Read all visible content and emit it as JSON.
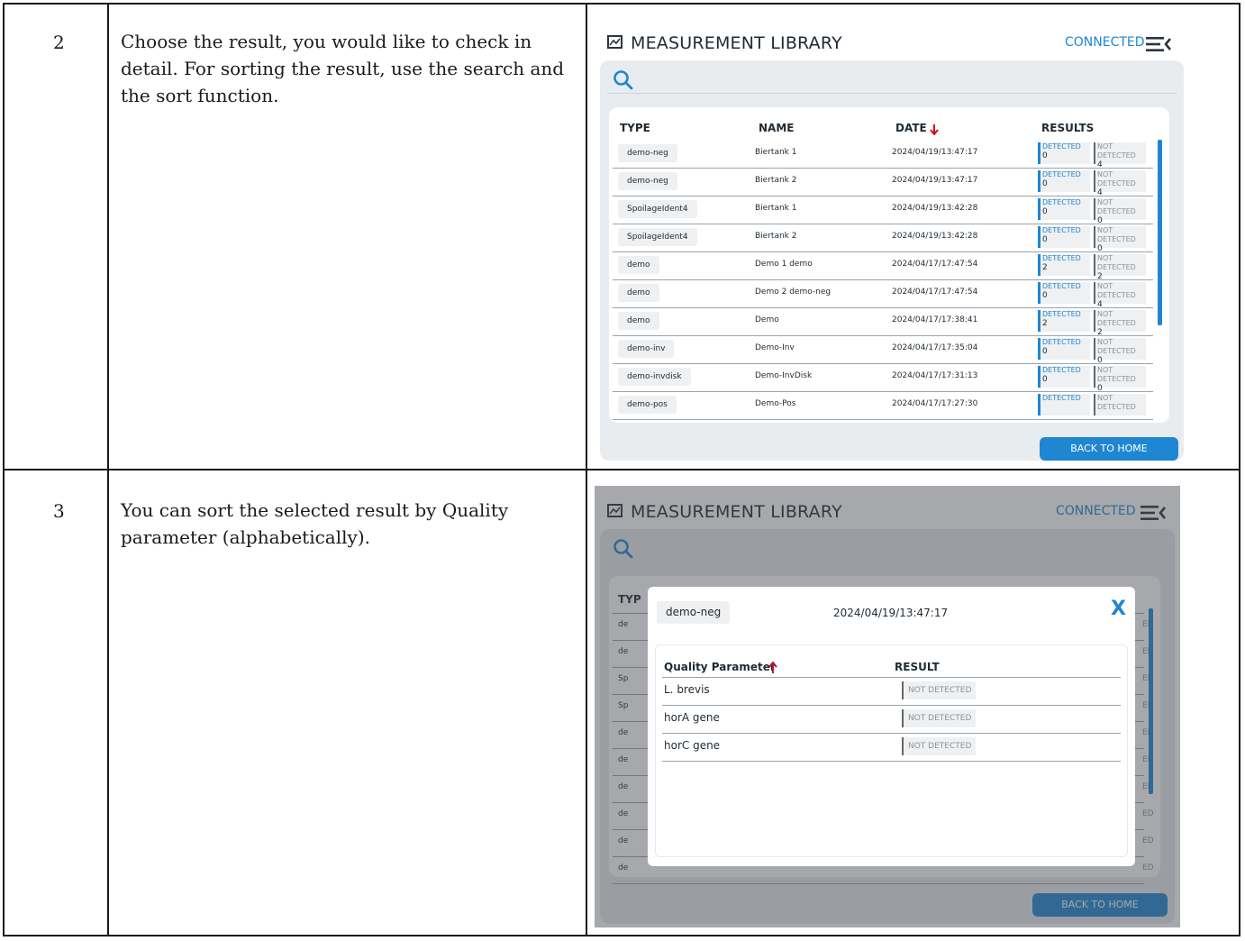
{
  "doc": {
    "rows": [
      {
        "step": "2",
        "text": "Choose the result, you would like to check in detail. For sorting the result, use the search and the sort function."
      },
      {
        "step": "3",
        "text": "You can sort the selected result by Quality parameter (alphabetically)."
      }
    ]
  },
  "app": {
    "title": "MEASUREMENT LIBRARY",
    "status": "CONNECTED",
    "back_to_home": "BACK TO HOME",
    "accent_color": "#1f86d3",
    "warning_color": "#d40f12"
  },
  "library": {
    "columns": {
      "type": "TYPE",
      "name": "NAME",
      "date": "DATE",
      "results": "RESULTS"
    },
    "detected_label": "DETECTED",
    "not_detected_label": "NOT DETECTED",
    "rows": [
      {
        "type": "demo-neg",
        "name": "Biertank 1",
        "date": "2024/04/19/13:47:17",
        "detected": "0",
        "not_detected": "4"
      },
      {
        "type": "demo-neg",
        "name": "Biertank 2",
        "date": "2024/04/19/13:47:17",
        "detected": "0",
        "not_detected": "4"
      },
      {
        "type": "SpoilageIdent4",
        "name": "Biertank 1",
        "date": "2024/04/19/13:42:28",
        "detected": "0",
        "not_detected": "0"
      },
      {
        "type": "SpoilageIdent4",
        "name": "Biertank 2",
        "date": "2024/04/19/13:42:28",
        "detected": "0",
        "not_detected": "0"
      },
      {
        "type": "demo",
        "name": "Demo 1 demo",
        "date": "2024/04/17/17:47:54",
        "detected": "2",
        "not_detected": "2"
      },
      {
        "type": "demo",
        "name": "Demo 2 demo-neg",
        "date": "2024/04/17/17:47:54",
        "detected": "0",
        "not_detected": "4"
      },
      {
        "type": "demo",
        "name": "Demo",
        "date": "2024/04/17/17:38:41",
        "detected": "2",
        "not_detected": "2"
      },
      {
        "type": "demo-inv",
        "name": "Demo-Inv",
        "date": "2024/04/17/17:35:04",
        "detected": "0",
        "not_detected": "0",
        "warning": "!"
      },
      {
        "type": "demo-invdisk",
        "name": "Demo-InvDisk",
        "date": "2024/04/17/17:31:13",
        "detected": "0",
        "not_detected": "0"
      },
      {
        "type": "demo-pos",
        "name": "Demo-Pos",
        "date": "2024/04/17/17:27:30",
        "detected": "",
        "not_detected": ""
      }
    ]
  },
  "detail": {
    "type": "demo-neg",
    "date": "2024/04/19/13:47:17",
    "close": "X",
    "col_param": "Quality Parameter",
    "col_result": "RESULT",
    "rows": [
      {
        "param": "L. brevis",
        "result": "NOT DETECTED"
      },
      {
        "param": "horA gene",
        "result": "NOT DETECTED"
      },
      {
        "param": "horC gene",
        "result": "NOT DETECTED"
      }
    ],
    "background_rows": [
      "TYP",
      "de",
      "de",
      "Sp",
      "Sp",
      "de",
      "de",
      "de",
      "de",
      "de",
      "de"
    ],
    "background_suffix": "ED"
  }
}
